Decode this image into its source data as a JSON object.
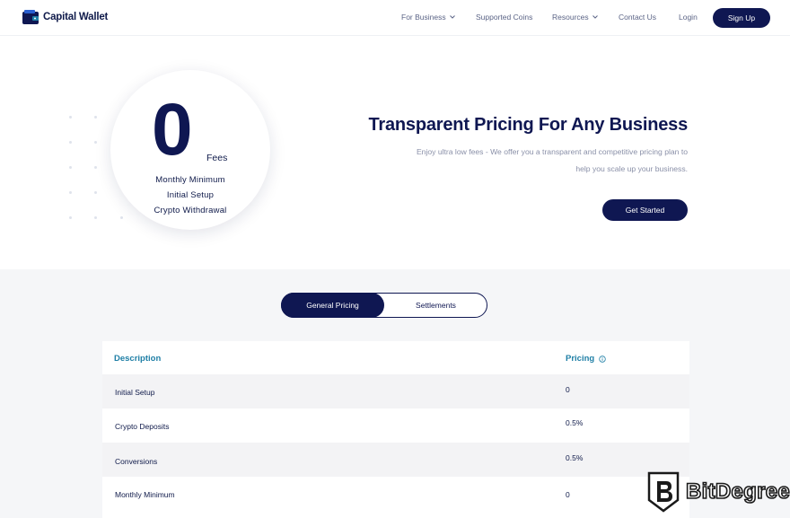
{
  "nav": {
    "logo_text": "Capital Wallet",
    "links": [
      {
        "label": "For Business",
        "has_dropdown": true
      },
      {
        "label": "Supported Coins",
        "has_dropdown": false
      },
      {
        "label": "Resources",
        "has_dropdown": true
      },
      {
        "label": "Contact Us",
        "has_dropdown": false
      },
      {
        "label": "Login",
        "has_dropdown": false
      }
    ],
    "signup_label": "Sign Up"
  },
  "hero": {
    "big_number": "0",
    "fees_label": "Fees",
    "circle_lines": [
      "Monthly Minimum",
      "Initial Setup",
      "Crypto Withdrawal"
    ],
    "title": "Transparent Pricing For Any Business",
    "subtitle_lines": [
      "Enjoy ultra low fees - We offer you a transparent and competitive pricing plan to",
      "help you scale up your business."
    ],
    "cta_label": "Get Started"
  },
  "pricing_toggle": {
    "options": [
      "General Pricing",
      "Settlements"
    ],
    "selected": "General Pricing"
  },
  "table": {
    "headers": {
      "description": "Description",
      "pricing": "Pricing"
    },
    "rows": [
      {
        "description": "Initial Setup",
        "pricing": "0"
      },
      {
        "description": "Crypto Deposits",
        "pricing": "0.5%"
      },
      {
        "description": "Conversions",
        "pricing": "0.5%"
      },
      {
        "description": "Monthly Minimum",
        "pricing": "0"
      }
    ]
  },
  "watermark": {
    "text": "BitDegree"
  },
  "colors": {
    "brand_navy": "#0f1752",
    "accent_teal": "#1f7fa6",
    "muted_text": "#8a90a8",
    "section_bg": "#f5f6f8"
  }
}
